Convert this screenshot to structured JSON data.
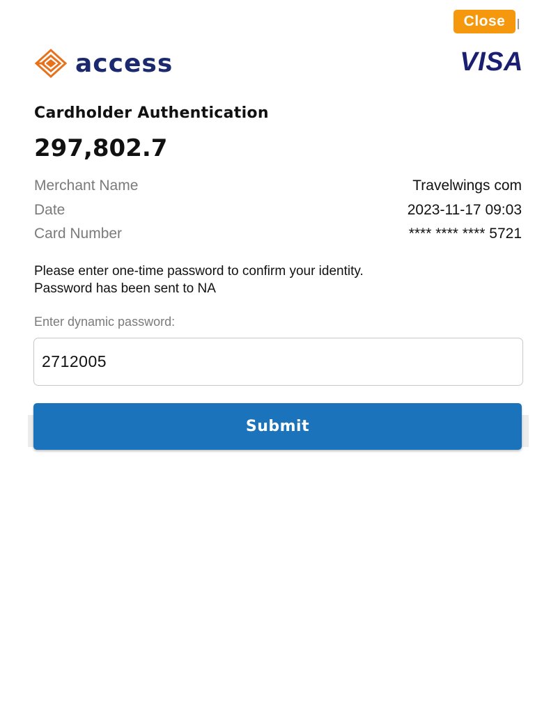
{
  "header": {
    "close_label": "Close",
    "bank_logo_text": "access",
    "card_network_logo_text": "VISA"
  },
  "auth": {
    "title": "Cardholder Authentication",
    "amount": "297,802.7"
  },
  "details": [
    {
      "label": "Merchant Name",
      "value": "Travelwings com"
    },
    {
      "label": "Date",
      "value": "2023-11-17 09:03"
    },
    {
      "label": "Card Number",
      "value": "**** **** **** 5721"
    }
  ],
  "message": {
    "line1": "Please enter one-time password to confirm your identity.",
    "line2": "Password has been sent to NA"
  },
  "password": {
    "label": "Enter dynamic password:",
    "value": "2712005"
  },
  "submit_label": "Submit",
  "colors": {
    "close_button": "#f5980d",
    "submit_button": "#1a73bb",
    "bank_brand_orange": "#e8711c",
    "bank_brand_navy": "#1b2a6e",
    "visa_blue": "#1a1f71"
  }
}
